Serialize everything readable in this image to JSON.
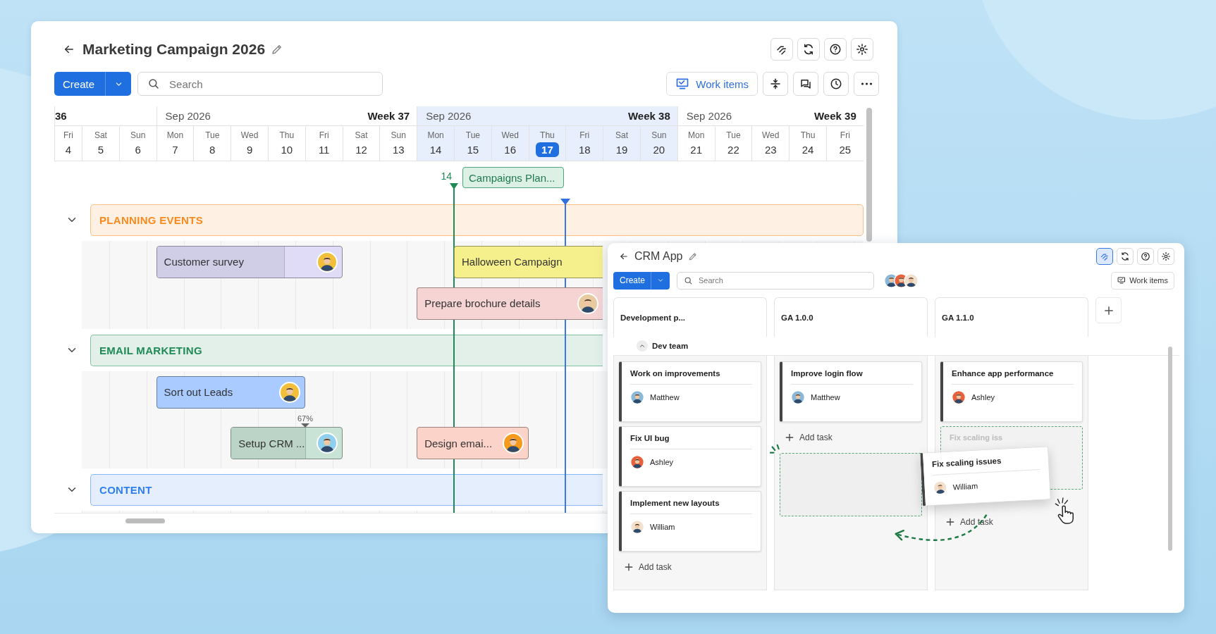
{
  "gantt": {
    "title": "Marketing Campaign 2026",
    "create_label": "Create",
    "search_placeholder": "Search",
    "work_items_label": "Work items",
    "weeks": [
      {
        "week": "36",
        "selected": false,
        "days": [
          {
            "weekday": "Fri",
            "date": "4",
            "selected": false
          },
          {
            "weekday": "Sat",
            "date": "5",
            "selected": false
          },
          {
            "weekday": "Sun",
            "date": "6",
            "selected": false
          }
        ]
      },
      {
        "month": "Sep 2026",
        "week": "Week 37",
        "selected": false,
        "days": [
          {
            "weekday": "Mon",
            "date": "7",
            "selected": false
          },
          {
            "weekday": "Tue",
            "date": "8",
            "selected": false
          },
          {
            "weekday": "Wed",
            "date": "9",
            "selected": false
          },
          {
            "weekday": "Thu",
            "date": "10",
            "selected": false
          },
          {
            "weekday": "Fri",
            "date": "11",
            "selected": false
          },
          {
            "weekday": "Sat",
            "date": "12",
            "selected": false
          },
          {
            "weekday": "Sun",
            "date": "13",
            "selected": false
          }
        ]
      },
      {
        "month": "Sep 2026",
        "week": "Week 38",
        "selected": true,
        "days": [
          {
            "weekday": "Mon",
            "date": "14",
            "selected": false
          },
          {
            "weekday": "Tue",
            "date": "15",
            "selected": false
          },
          {
            "weekday": "Wed",
            "date": "16",
            "selected": false
          },
          {
            "weekday": "Thu",
            "date": "17",
            "selected": true
          },
          {
            "weekday": "Fri",
            "date": "18",
            "selected": false
          },
          {
            "weekday": "Sat",
            "date": "19",
            "selected": false
          },
          {
            "weekday": "Sun",
            "date": "20",
            "selected": false
          }
        ]
      },
      {
        "month": "Sep 2026",
        "week": "Week 39",
        "selected": false,
        "days": [
          {
            "weekday": "Mon",
            "date": "21",
            "selected": false
          },
          {
            "weekday": "Tue",
            "date": "22",
            "selected": false
          },
          {
            "weekday": "Wed",
            "date": "23",
            "selected": false
          },
          {
            "weekday": "Thu",
            "date": "24",
            "selected": false
          },
          {
            "weekday": "Fri",
            "date": "25",
            "selected": false
          }
        ]
      }
    ],
    "milestone": {
      "marker": "14",
      "label": "Campaigns Plan..."
    },
    "groups": [
      {
        "title": "PLANNING EVENTS",
        "color": "#f78b1f",
        "expanded": true,
        "tasks": [
          {
            "label": "Customer survey",
            "color": "#e0dcf8",
            "level": 0.69,
            "avatar": {
              "color": "#f2bf3a"
            }
          },
          {
            "label": "Halloween Campaign",
            "color": "#f6f08c"
          },
          {
            "label": "Prepare brochure details",
            "color": "#f6d4d4",
            "avatar": {
              "color": "#e9c9a0"
            }
          }
        ]
      },
      {
        "title": "EMAIL MARKETING",
        "color": "#1f8a55",
        "expanded": true,
        "tasks": [
          {
            "label": "Sort out Leads",
            "color": "#a9cbff",
            "avatar": {
              "color": "#f2bf3a"
            }
          },
          {
            "label": "Setup CRM ...",
            "color": "#c9e4d6",
            "level": 0.67,
            "progress_label": "67%",
            "avatar": {
              "color": "#8fd0ee"
            }
          },
          {
            "label": "Design emai...",
            "color": "#fcd3c8",
            "avatar": {
              "color": "#f59a1c"
            }
          }
        ]
      },
      {
        "title": "CONTENT",
        "color": "#2f7ef0",
        "expanded": true
      }
    ]
  },
  "crm": {
    "title": "CRM App",
    "header_buttons": [
      {
        "selected": true
      },
      {
        "selected": false
      },
      {
        "selected": false
      },
      {
        "selected": false
      }
    ],
    "create_label": "Create",
    "search_placeholder": "Search",
    "members": [
      {
        "color": "#8ab8d8"
      },
      {
        "color": "#e8603c"
      },
      {
        "color": "#f3e1cf"
      }
    ],
    "work_items_label": "Work items",
    "swimlane": {
      "title": "Dev team",
      "expanded": true
    },
    "columns": [
      {
        "title": "Development p...",
        "items": [
          {
            "kind": "card",
            "title": "Work on improvements",
            "assignee": "Matthew",
            "avatar": {
              "color": "#8ab8d8"
            }
          },
          {
            "kind": "card",
            "title": "Fix UI bug",
            "assignee": "Ashley",
            "avatar": {
              "color": "#e8603c"
            }
          },
          {
            "kind": "card",
            "title": "Implement new layouts",
            "assignee": "William",
            "avatar": {
              "color": "#f3e1cf"
            }
          },
          {
            "kind": "add",
            "label": "Add task"
          }
        ]
      },
      {
        "title": "GA 1.0.0",
        "items": [
          {
            "kind": "card",
            "title": "Improve login flow",
            "assignee": "Matthew",
            "avatar": {
              "color": "#8ab8d8"
            }
          },
          {
            "kind": "add",
            "label": "Add task"
          },
          {
            "kind": "drop_zone"
          }
        ]
      },
      {
        "title": "GA 1.1.0",
        "items": [
          {
            "kind": "card",
            "title": "Enhance app performance",
            "assignee": "Ashley",
            "avatar": {
              "color": "#e8603c"
            }
          },
          {
            "kind": "ghost",
            "title": "Fix scaling iss"
          },
          {
            "kind": "add",
            "label": "Add task"
          }
        ]
      }
    ],
    "dragged_card": {
      "title": "Fix scaling issues",
      "assignee": "William",
      "avatar": {
        "color": "#f3e1cf"
      }
    }
  }
}
